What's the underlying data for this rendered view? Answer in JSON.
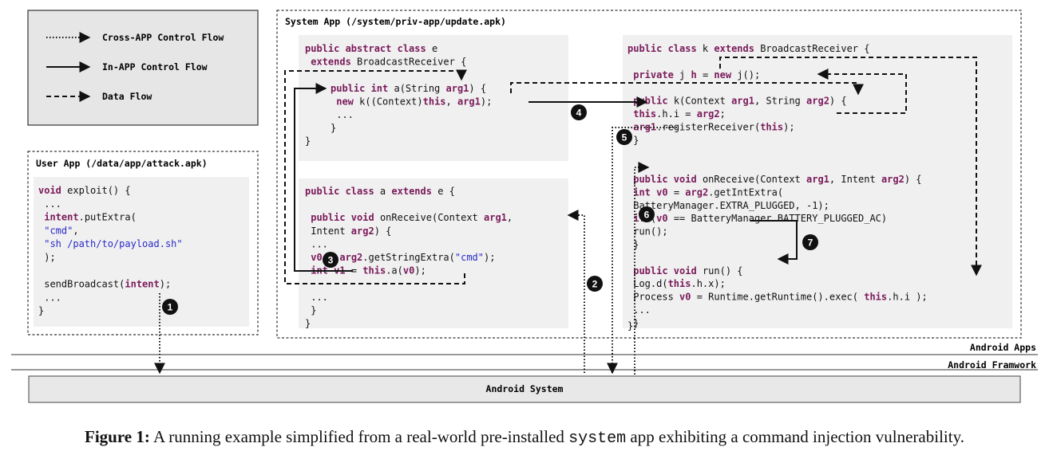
{
  "legend": {
    "cross_app": "Cross-APP Control Flow",
    "in_app": "In-APP Control Flow",
    "data_flow": "Data Flow"
  },
  "user_app": {
    "title": "User App (/data/app/attack.apk)",
    "lines": [
      [
        {
          "t": "void",
          "k": "kw"
        },
        {
          "t": " exploit() {"
        }
      ],
      [
        {
          "t": "    ..."
        }
      ],
      [
        {
          "t": "    "
        },
        {
          "t": "intent",
          "k": "kw"
        },
        {
          "t": ".putExtra("
        }
      ],
      [
        {
          "t": "        "
        },
        {
          "t": "\"cmd\"",
          "k": "str"
        },
        {
          "t": ","
        }
      ],
      [
        {
          "t": "        "
        },
        {
          "t": "\"sh /path/to/payload.sh\"",
          "k": "str"
        }
      ],
      [
        {
          "t": "    );"
        }
      ],
      [
        {
          "t": ""
        }
      ],
      [
        {
          "t": "    sendBroadcast("
        },
        {
          "t": "intent",
          "k": "kw"
        },
        {
          "t": ");"
        }
      ],
      [
        {
          "t": "    ..."
        }
      ],
      [
        {
          "t": "}"
        }
      ]
    ]
  },
  "system_app": {
    "title": "System App (/system/priv-app/update.apk)",
    "class_e": [
      [
        {
          "t": "public abstract class",
          "k": "kw"
        },
        {
          "t": " e"
        }
      ],
      [
        {
          "t": "       "
        },
        {
          "t": "extends",
          "k": "kw"
        },
        {
          "t": " BroadcastReceiver {"
        }
      ]
    ],
    "method_a": [
      [
        {
          "t": "public int",
          "k": "kw"
        },
        {
          "t": " a(String "
        },
        {
          "t": "arg1",
          "k": "kw"
        },
        {
          "t": ") {"
        }
      ],
      [
        {
          "t": "    "
        },
        {
          "t": "new",
          "k": "kw"
        },
        {
          "t": " k((Context)"
        },
        {
          "t": "this",
          "k": "kw"
        },
        {
          "t": ", "
        },
        {
          "t": "arg1",
          "k": "kw"
        },
        {
          "t": ");"
        }
      ],
      [
        {
          "t": "    ..."
        }
      ],
      [
        {
          "t": "}"
        }
      ]
    ],
    "class_e_close": "}",
    "class_a": [
      [
        {
          "t": "public class",
          "k": "kw"
        },
        {
          "t": " a "
        },
        {
          "t": "extends",
          "k": "kw"
        },
        {
          "t": " e {"
        }
      ],
      [
        {
          "t": ""
        }
      ],
      [
        {
          "t": "    "
        },
        {
          "t": "public void",
          "k": "kw"
        },
        {
          "t": " onReceive(Context "
        },
        {
          "t": "arg1",
          "k": "kw"
        },
        {
          "t": ","
        }
      ],
      [
        {
          "t": "                        Intent "
        },
        {
          "t": "arg2",
          "k": "kw"
        },
        {
          "t": ") {"
        }
      ],
      [
        {
          "t": "        ..."
        }
      ],
      [
        {
          "t": "        "
        },
        {
          "t": "v0",
          "k": "kw"
        },
        {
          "t": " = "
        },
        {
          "t": "arg2",
          "k": "kw"
        },
        {
          "t": ".getStringExtra("
        },
        {
          "t": "\"cmd\"",
          "k": "str"
        },
        {
          "t": ");"
        }
      ],
      [
        {
          "t": "        "
        },
        {
          "t": "int",
          "k": "kw"
        },
        {
          "t": " "
        },
        {
          "t": "v1",
          "k": "kw"
        },
        {
          "t": " = "
        },
        {
          "t": "this",
          "k": "kw"
        },
        {
          "t": ".a("
        },
        {
          "t": "v0",
          "k": "kw"
        },
        {
          "t": ");"
        }
      ],
      [
        {
          "t": ""
        }
      ],
      [
        {
          "t": "        ..."
        }
      ],
      [
        {
          "t": "    }"
        }
      ],
      [
        {
          "t": "}"
        }
      ]
    ],
    "class_k": [
      [
        {
          "t": "public class",
          "k": "kw"
        },
        {
          "t": " k "
        },
        {
          "t": "extends",
          "k": "kw"
        },
        {
          "t": " BroadcastReceiver {"
        }
      ],
      [
        {
          "t": ""
        }
      ],
      [
        {
          "t": "    "
        },
        {
          "t": "private",
          "k": "kw"
        },
        {
          "t": " j "
        },
        {
          "t": "h",
          "k": "kw"
        },
        {
          "t": " = "
        },
        {
          "t": "new",
          "k": "kw"
        },
        {
          "t": " j();"
        }
      ],
      [
        {
          "t": ""
        }
      ],
      [
        {
          "t": "    "
        },
        {
          "t": "public",
          "k": "kw"
        },
        {
          "t": " k(Context "
        },
        {
          "t": "arg1",
          "k": "kw"
        },
        {
          "t": ", String "
        },
        {
          "t": "arg2",
          "k": "kw"
        },
        {
          "t": ") {"
        }
      ],
      [
        {
          "t": "        "
        },
        {
          "t": "this",
          "k": "kw"
        },
        {
          "t": ".h.i = "
        },
        {
          "t": "arg2",
          "k": "kw"
        },
        {
          "t": ";"
        }
      ],
      [
        {
          "t": "        "
        },
        {
          "t": "arg1",
          "k": "kw"
        },
        {
          "t": ".registerReceiver("
        },
        {
          "t": "this",
          "k": "kw"
        },
        {
          "t": ");"
        }
      ],
      [
        {
          "t": "    }"
        }
      ],
      [
        {
          "t": ""
        }
      ],
      [
        {
          "t": ""
        }
      ],
      [
        {
          "t": "    "
        },
        {
          "t": "public void",
          "k": "kw"
        },
        {
          "t": " onReceive(Context "
        },
        {
          "t": "arg1",
          "k": "kw"
        },
        {
          "t": ", Intent "
        },
        {
          "t": "arg2",
          "k": "kw"
        },
        {
          "t": ") {"
        }
      ],
      [
        {
          "t": "        "
        },
        {
          "t": "int",
          "k": "kw"
        },
        {
          "t": " "
        },
        {
          "t": "v0",
          "k": "kw"
        },
        {
          "t": " = "
        },
        {
          "t": "arg2",
          "k": "kw"
        },
        {
          "t": ".getIntExtra("
        }
      ],
      [
        {
          "t": "                BatteryManager.EXTRA_PLUGGED, -1);"
        }
      ],
      [
        {
          "t": "        "
        },
        {
          "t": "if",
          "k": "kw"
        },
        {
          "t": " ("
        },
        {
          "t": "v0",
          "k": "kw"
        },
        {
          "t": " == BatteryManager.BATTERY_PLUGGED_AC)"
        }
      ],
      [
        {
          "t": "            run();"
        }
      ],
      [
        {
          "t": "    }"
        }
      ],
      [
        {
          "t": ""
        }
      ],
      [
        {
          "t": "    "
        },
        {
          "t": "public void",
          "k": "kw"
        },
        {
          "t": " run() {"
        }
      ],
      [
        {
          "t": "        Log.d("
        },
        {
          "t": "this",
          "k": "kw"
        },
        {
          "t": ".h.x);"
        }
      ],
      [
        {
          "t": "        Process "
        },
        {
          "t": "v0",
          "k": "kw"
        },
        {
          "t": " = Runtime.getRuntime().exec( "
        },
        {
          "t": "this",
          "k": "kw"
        },
        {
          "t": ".h.i );"
        }
      ],
      [
        {
          "t": "        ..."
        }
      ],
      [
        {
          "t": "    }"
        }
      ]
    ],
    "class_k_close": "}"
  },
  "layers": {
    "apps": "Android Apps",
    "framework": "Android Framwork",
    "system": "Android System"
  },
  "badges": [
    "1",
    "2",
    "3",
    "4",
    "5",
    "6",
    "7"
  ],
  "caption": {
    "label": "Figure 1:",
    "text_before": " A running example simplified from a real-world pre-installed ",
    "code": "system",
    "text_after": " app exhibiting a command injection vulnerability."
  }
}
